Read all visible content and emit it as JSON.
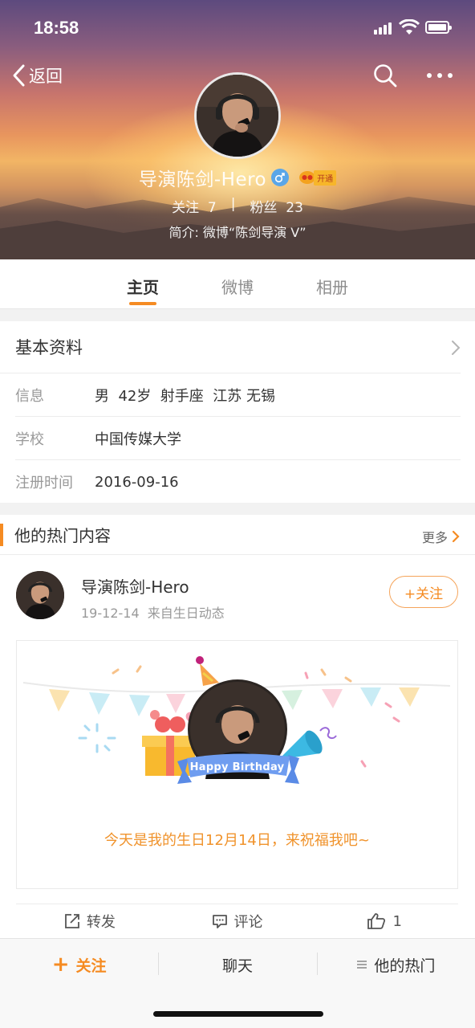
{
  "status_bar": {
    "time": "18:58"
  },
  "header": {
    "back_label": "返回",
    "name": "导演陈剑-Hero",
    "vip_badge": "开通",
    "following_label": "关注",
    "following_count": "7",
    "separator": "|",
    "fans_label": "粉丝",
    "fans_count": "23",
    "intro": "简介: 微博“陈剑导演 V”"
  },
  "tabs": [
    {
      "label": "主页",
      "active": true
    },
    {
      "label": "微博",
      "active": false
    },
    {
      "label": "相册",
      "active": false
    }
  ],
  "basic_info": {
    "title": "基本资料",
    "rows": [
      {
        "key": "信息",
        "value": "男  42岁  射手座  江苏 无锡"
      },
      {
        "key": "学校",
        "value": "中国传媒大学"
      },
      {
        "key": "注册时间",
        "value": "2016-09-16"
      }
    ]
  },
  "hot": {
    "title": "他的热门内容",
    "more_label": "更多",
    "post": {
      "author": "导演陈剑-Hero",
      "meta": "19-12-14  来自生日动态",
      "follow_label": "+关注",
      "card_ribbon": "Happy Birthday",
      "card_message": "今天是我的生日12月14日，来祝福我吧~"
    },
    "actions": {
      "repost": "转发",
      "comment": "评论",
      "like_count": "1"
    }
  },
  "bottom_bar": {
    "follow": "关注",
    "plus": "+",
    "chat": "聊天",
    "hot": "他的热门"
  },
  "colors": {
    "accent": "#f58b22",
    "gender_badge": "#5aa6e8"
  }
}
